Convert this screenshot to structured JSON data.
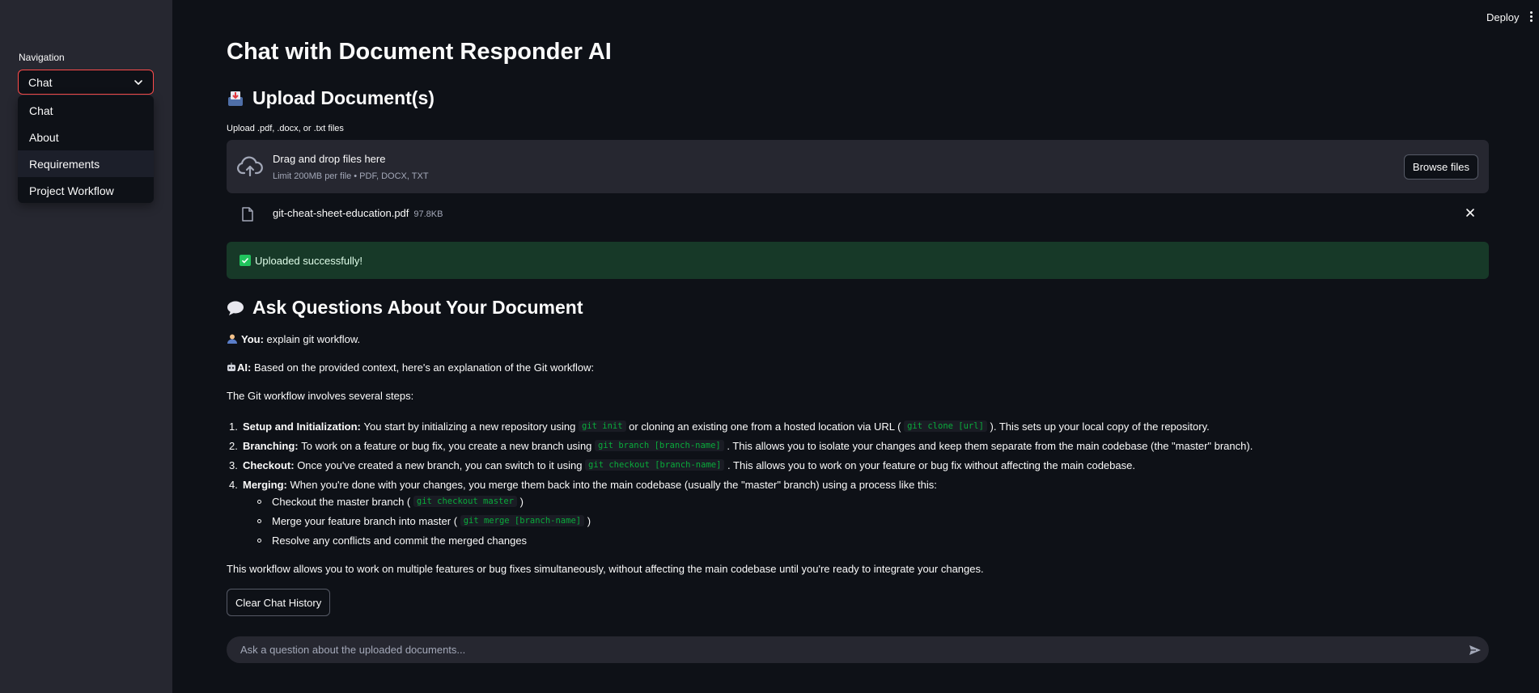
{
  "header": {
    "deploy_label": "Deploy"
  },
  "sidebar": {
    "nav_label": "Navigation",
    "selected": "Chat",
    "options": [
      "Chat",
      "About",
      "Requirements",
      "Project Workflow"
    ]
  },
  "main": {
    "title": "Chat with Document Responder AI",
    "upload_heading": "Upload Document(s)",
    "upload_caption": "Upload .pdf, .docx, or .txt files",
    "dropzone_title": "Drag and drop files here",
    "dropzone_sub": "Limit 200MB per file • PDF, DOCX, TXT",
    "browse_label": "Browse files",
    "file_name": "git-cheat-sheet-education.pdf",
    "file_size": "97.8KB",
    "success_text": "Uploaded successfully!",
    "ask_heading": "Ask Questions About Your Document",
    "clear_label": "Clear Chat History",
    "input_placeholder": "Ask a question about the uploaded documents..."
  },
  "chat": {
    "user_label": "You:",
    "user_msg": "explain git workflow.",
    "ai_label": "AI:",
    "ai_intro": "Based on the provided context, here's an explanation of the Git workflow:",
    "ai_lead": "The Git workflow involves several steps:",
    "steps": [
      {
        "num": "1.",
        "title": "Setup and Initialization:",
        "t1": "You start by initializing a new repository using",
        "c1": "git init",
        "t2": "or cloning an existing one from a hosted location via URL (",
        "c2": "git clone [url]",
        "t3": "). This sets up your local copy of the repository."
      },
      {
        "num": "2.",
        "title": "Branching:",
        "t1": "To work on a feature or bug fix, you create a new branch using",
        "c1": "git branch [branch-name]",
        "t2": ". This allows you to isolate your changes and keep them separate from the main codebase (the \"master\" branch)."
      },
      {
        "num": "3.",
        "title": "Checkout:",
        "t1": "Once you've created a new branch, you can switch to it using",
        "c1": "git checkout [branch-name]",
        "t2": ". This allows you to work on your feature or bug fix without affecting the main codebase."
      },
      {
        "num": "4.",
        "title": "Merging:",
        "t1": "When you're done with your changes, you merge them back into the main codebase (usually the \"master\" branch) using a process like this:"
      }
    ],
    "substeps": [
      {
        "t1": "Checkout the master branch (",
        "c1": "git checkout master",
        "t2": ")"
      },
      {
        "t1": "Merge your feature branch into master (",
        "c1": "git merge [branch-name]",
        "t2": ")"
      },
      {
        "t1": "Resolve any conflicts and commit the merged changes"
      }
    ],
    "ai_outro": "This workflow allows you to work on multiple features or bug fixes simultaneously, without affecting the main codebase until you're ready to integrate your changes."
  },
  "colors": {
    "accent": "#ff4b4b",
    "success_bg": "#173928",
    "code": "#09ab3b",
    "sidebar_bg": "#262730",
    "page_bg": "#0e1117"
  },
  "icons": [
    "chevron-down-icon",
    "inbox-tray-icon",
    "cloud-upload-icon",
    "file-icon",
    "close-icon",
    "check-icon",
    "speech-bubble-icon",
    "user-icon",
    "robot-icon",
    "send-icon",
    "kebab-menu-icon"
  ]
}
